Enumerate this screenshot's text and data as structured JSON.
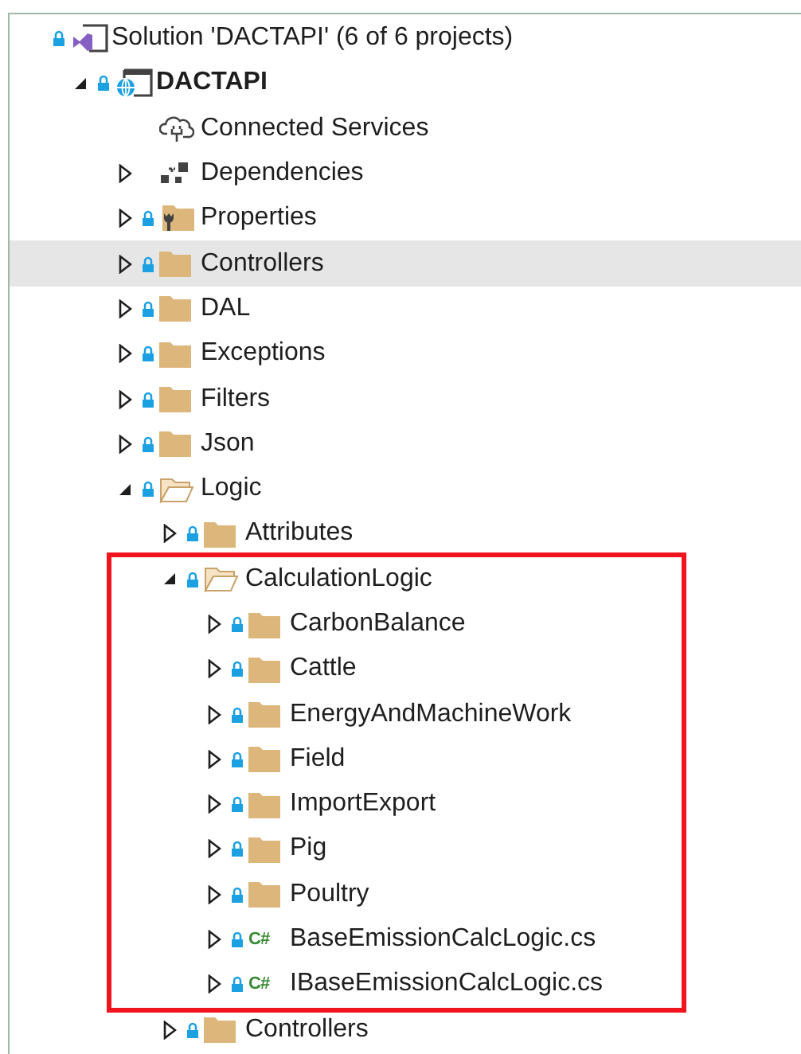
{
  "tree": [
    {
      "label": "Solution 'DACTAPI' (6 of 6 projects)",
      "kind": "solution",
      "locked": true,
      "selected": false,
      "children": [
        {
          "label": "DACTAPI",
          "kind": "webproject",
          "locked": true,
          "bold": true,
          "expanded": true,
          "selected": false,
          "children": [
            {
              "label": "Connected Services",
              "kind": "cloud",
              "locked": false,
              "selected": false
            },
            {
              "label": "Dependencies",
              "kind": "dependencies",
              "locked": false,
              "expanded": false,
              "selected": false
            },
            {
              "label": "Properties",
              "kind": "properties",
              "locked": true,
              "expanded": false,
              "selected": false
            },
            {
              "label": "Controllers",
              "kind": "folder",
              "locked": true,
              "expanded": false,
              "selected": true
            },
            {
              "label": "DAL",
              "kind": "folder",
              "locked": true,
              "expanded": false,
              "selected": false
            },
            {
              "label": "Exceptions",
              "kind": "folder",
              "locked": true,
              "expanded": false,
              "selected": false
            },
            {
              "label": "Filters",
              "kind": "folder",
              "locked": true,
              "expanded": false,
              "selected": false
            },
            {
              "label": "Json",
              "kind": "folder",
              "locked": true,
              "expanded": false,
              "selected": false
            },
            {
              "label": "Logic",
              "kind": "folder",
              "locked": true,
              "expanded": true,
              "selected": false,
              "children": [
                {
                  "label": "Attributes",
                  "kind": "folder",
                  "locked": true,
                  "expanded": false,
                  "selected": false
                },
                {
                  "label": "CalculationLogic",
                  "kind": "folder",
                  "locked": true,
                  "expanded": true,
                  "highlighted": true,
                  "selected": false,
                  "children": [
                    {
                      "label": "CarbonBalance",
                      "kind": "folder",
                      "locked": true,
                      "expanded": false,
                      "selected": false
                    },
                    {
                      "label": "Cattle",
                      "kind": "folder",
                      "locked": true,
                      "expanded": false,
                      "selected": false
                    },
                    {
                      "label": "EnergyAndMachineWork",
                      "kind": "folder",
                      "locked": true,
                      "expanded": false,
                      "selected": false
                    },
                    {
                      "label": "Field",
                      "kind": "folder",
                      "locked": true,
                      "expanded": false,
                      "selected": false
                    },
                    {
                      "label": "ImportExport",
                      "kind": "folder",
                      "locked": true,
                      "expanded": false,
                      "selected": false
                    },
                    {
                      "label": "Pig",
                      "kind": "folder",
                      "locked": true,
                      "expanded": false,
                      "selected": false
                    },
                    {
                      "label": "Poultry",
                      "kind": "folder",
                      "locked": true,
                      "expanded": false,
                      "selected": false
                    },
                    {
                      "label": "BaseEmissionCalcLogic.cs",
                      "kind": "csharp",
                      "badge": "C#",
                      "locked": true,
                      "expanded": false,
                      "selected": false
                    },
                    {
                      "label": "IBaseEmissionCalcLogic.cs",
                      "kind": "csharp",
                      "badge": "C#",
                      "locked": true,
                      "expanded": false,
                      "selected": false
                    }
                  ]
                },
                {
                  "label": "Controllers",
                  "kind": "folder",
                  "locked": true,
                  "expanded": false,
                  "selected": false
                }
              ]
            }
          ]
        }
      ]
    }
  ]
}
